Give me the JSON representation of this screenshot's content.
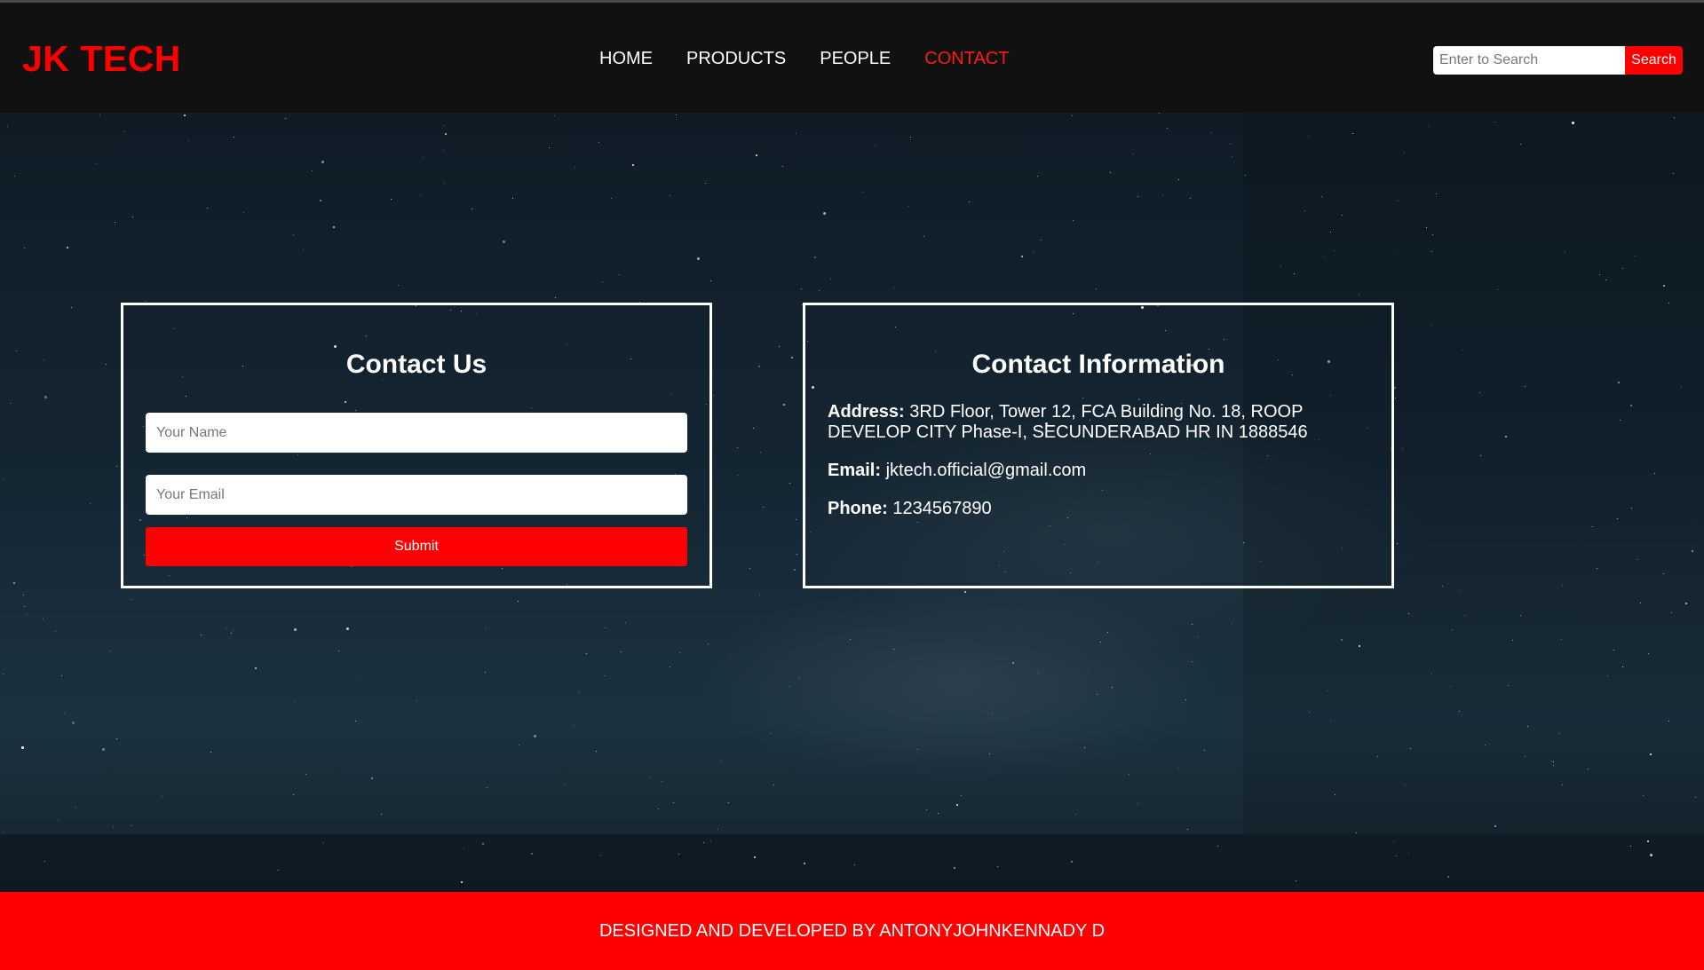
{
  "header": {
    "brand": "JK TECH",
    "nav": [
      {
        "label": "HOME"
      },
      {
        "label": "PRODUCTS"
      },
      {
        "label": "PEOPLE"
      },
      {
        "label": "CONTACT",
        "active": true
      }
    ],
    "search": {
      "placeholder": "Enter to Search",
      "button_label": "Search"
    }
  },
  "contact_form": {
    "title": "Contact Us",
    "name_placeholder": "Your Name",
    "email_placeholder": "Your Email",
    "submit_label": "Submit"
  },
  "contact_info": {
    "title": "Contact Information",
    "address_label": "Address:",
    "address_value": "3RD Floor, Tower 12, FCA Building No. 18, ROOP DEVELOP CITY Phase-I, SECUNDERABAD HR IN 1888546",
    "email_label": "Email:",
    "email_value": "jktech.official@gmail.com",
    "phone_label": "Phone:",
    "phone_value": "1234567890"
  },
  "footer": {
    "text": "DESIGNED AND DEVELOPED BY ANTONYJOHNKENNADY D"
  },
  "colors": {
    "accent": "#ff0000",
    "header_bg": "#111111",
    "text": "#ffffff"
  }
}
